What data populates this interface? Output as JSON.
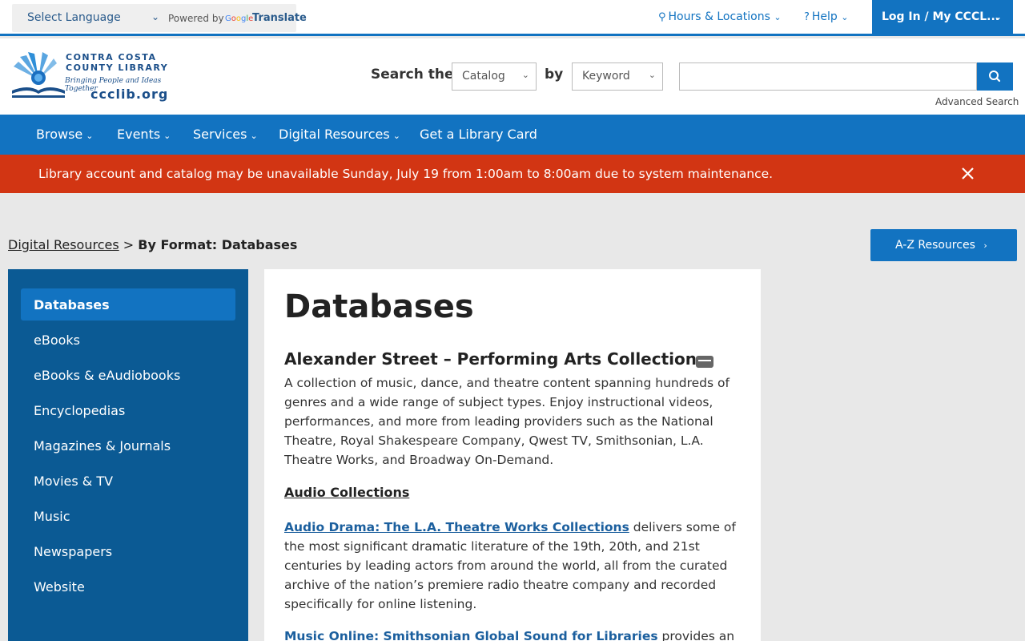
{
  "topbar": {
    "select_language": "Select Language",
    "powered_by": "Powered by",
    "google": [
      "G",
      "o",
      "o",
      "g",
      "l",
      "e"
    ],
    "translate": "Translate",
    "hours_locations": "Hours & Locations",
    "help": "Help",
    "login": "Log In / My CCCL..."
  },
  "logo": {
    "line1": "CONTRA COSTA",
    "line2": "COUNTY LIBRARY",
    "tagline": "Bringing People and Ideas Together",
    "url": "ccclib.org"
  },
  "search": {
    "label": "Search the",
    "scope": "Catalog",
    "by": "by",
    "type": "Keyword",
    "advanced": "Advanced Search"
  },
  "nav": {
    "browse": "Browse",
    "events": "Events",
    "services": "Services",
    "digital": "Digital Resources",
    "card": "Get a Library Card"
  },
  "alert": {
    "message": "Library account and catalog may be unavailable Sunday, July 19 from 1:00am to 8:00am due to system maintenance."
  },
  "breadcrumb": {
    "parent": "Digital Resources",
    "sep": ">",
    "current": "By Format: Databases"
  },
  "az_button": "A-Z Resources",
  "sidebar": {
    "items": [
      {
        "label": "Databases"
      },
      {
        "label": "eBooks"
      },
      {
        "label": "eBooks & eAudiobooks"
      },
      {
        "label": "Encyclopedias"
      },
      {
        "label": "Magazines & Journals"
      },
      {
        "label": "Movies & TV"
      },
      {
        "label": "Music"
      },
      {
        "label": "Newspapers"
      },
      {
        "label": "Website"
      }
    ]
  },
  "content": {
    "heading": "Databases",
    "resource_title": "Alexander Street – Performing Arts Collection »",
    "description": "A collection of music, dance, and theatre content spanning hundreds of genres and a wide range of subject types. Enjoy instructional videos, performances, and more from leading providers such as the National Theatre, Royal Shakespeare Company, Qwest TV, Smithsonian, L.A. Theatre Works, and Broadway On-Demand.",
    "subheading": "Audio Collections",
    "item1_link": "Audio Drama: The L.A. Theatre Works Collections",
    "item1_text": " delivers some of the most significant dramatic literature of the 19th, 20th, and 21st centuries by leading actors from around the world, all from the curated archive of the nation’s premiere radio theatre company and recorded specifically for online listening.",
    "item2_link": "Music Online: Smithsonian Global Sound for Libraries",
    "item2_text": " provides an"
  }
}
